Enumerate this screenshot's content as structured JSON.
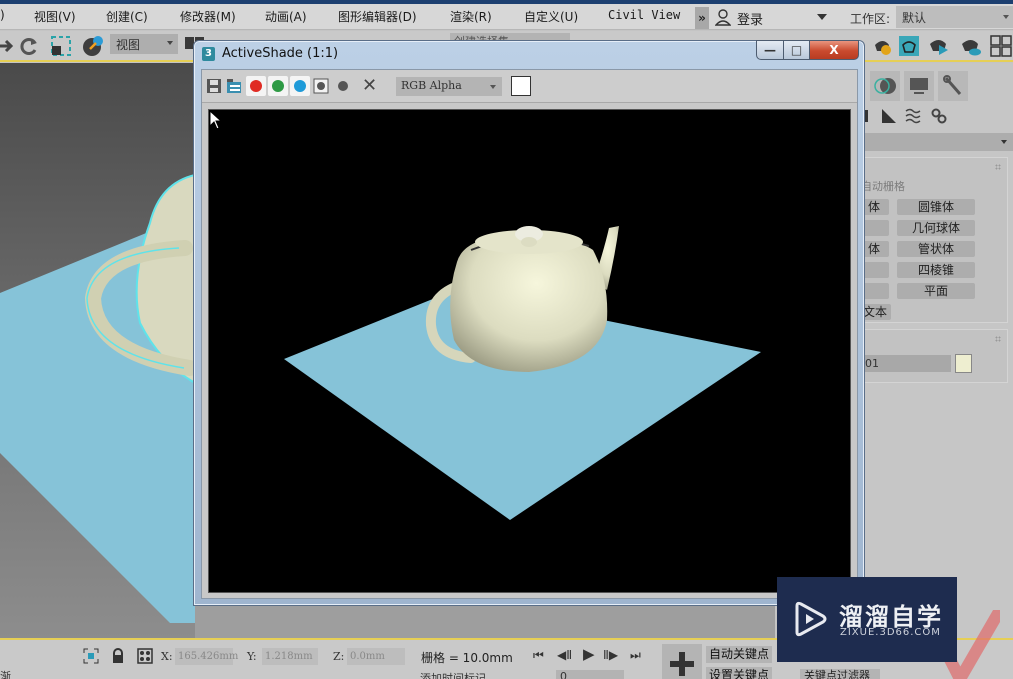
{
  "menubar": {
    "items": [
      {
        "label": ")"
      },
      {
        "label": "视图(V)"
      },
      {
        "label": "创建(C)"
      },
      {
        "label": "修改器(M)"
      },
      {
        "label": "动画(A)"
      },
      {
        "label": "图形编辑器(D)"
      },
      {
        "label": "渲染(R)"
      },
      {
        "label": "自定义(U)"
      },
      {
        "label": "Civil View"
      }
    ],
    "overflow_label": "»",
    "login_label": "登录",
    "workspace_label": "工作区:",
    "workspace_value": "默认"
  },
  "toolbar": {
    "view_select": "视图",
    "selection_set": "创建选择集"
  },
  "dialog": {
    "app_icon": "3",
    "title": "ActiveShade (1:1)",
    "minimize_glyph": "—",
    "maximize_glyph": "□",
    "close_glyph": "X",
    "channels": [
      {
        "name": "red",
        "color": "#e02b23"
      },
      {
        "name": "green",
        "color": "#2e9a45"
      },
      {
        "name": "blue",
        "color": "#1e9ad8"
      }
    ],
    "channel_select": "RGB Alpha",
    "background_swatch": "#ffffff",
    "clear_glyph": "✕"
  },
  "scene": {
    "plane_color": "#86c3d8",
    "teapot_color": "#e8e8cf",
    "background": "#000000"
  },
  "command_panel": {
    "autogrid_label": "自动栅格",
    "primitives": [
      {
        "left": "体",
        "right": "圆锥体"
      },
      {
        "left": "",
        "right": "几何球体"
      },
      {
        "left": "体",
        "right": "管状体"
      },
      {
        "left": "",
        "right": "四棱锥"
      },
      {
        "left": "",
        "right": "平面"
      },
      {
        "left": "文本",
        "right": ""
      }
    ],
    "object_name": "01",
    "object_color": "#eeeed0"
  },
  "statusbar": {
    "x_label": "X:",
    "x_value": "165.426mm",
    "y_label": "Y:",
    "y_value": "1.218mm",
    "z_label": "Z:",
    "z_value": "0.0mm",
    "grid": "栅格 = 10.0mm",
    "add_time_tag": "添加时间标记",
    "left_status": "渐",
    "frame_value": "0",
    "auto_key": "自动关键点",
    "set_key": "设置关键点",
    "key_filters": "关键点过滤器"
  },
  "playback": {
    "go_start": "⏮",
    "prev_frame": "◀Ⅱ",
    "play": "▶",
    "next_frame": "Ⅱ▶",
    "go_end": "⏭"
  },
  "watermark": {
    "title": "溜溜自学",
    "url": "ZIXUE.3D66.COM"
  }
}
